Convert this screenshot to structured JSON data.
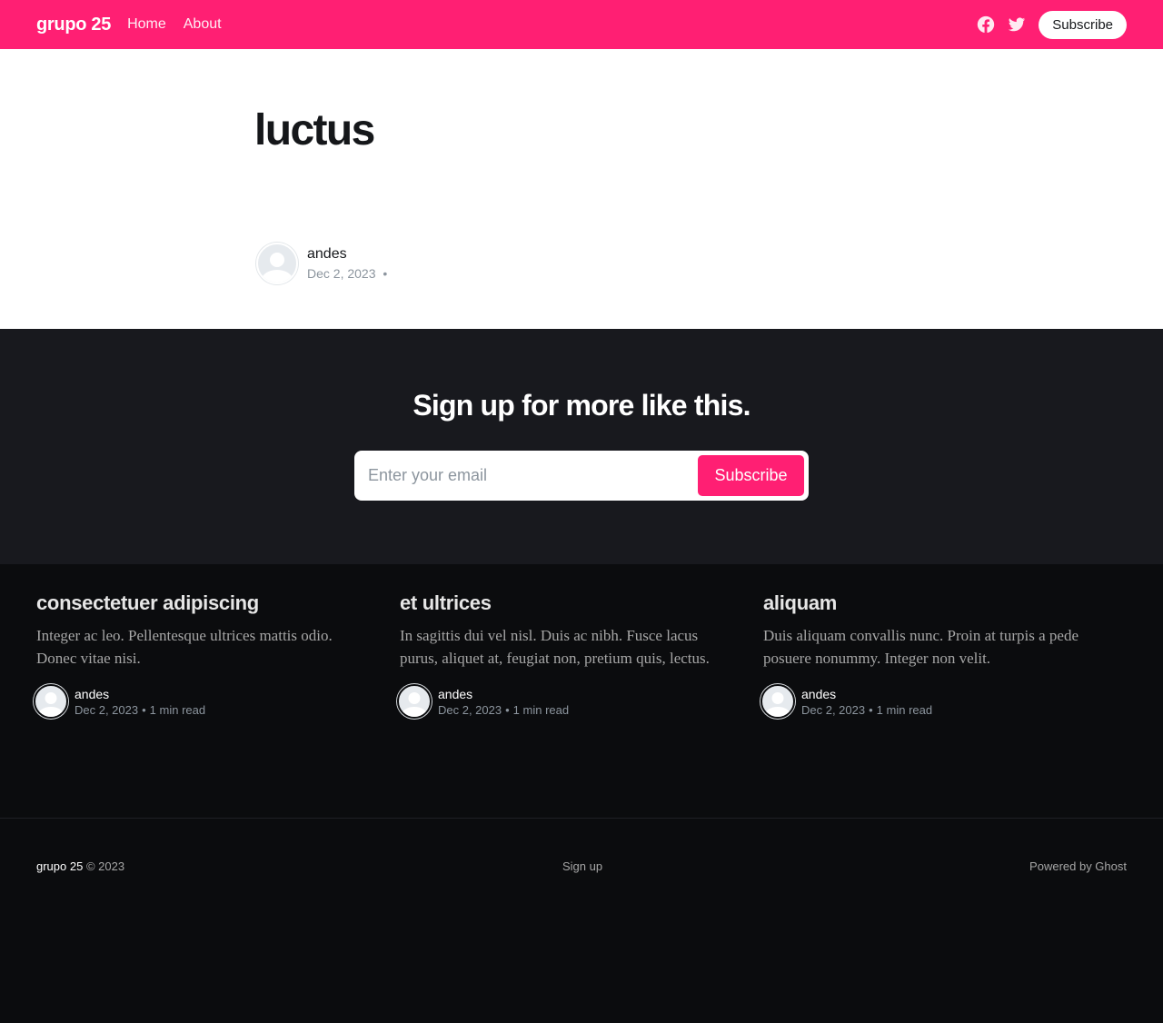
{
  "header": {
    "logo": "grupo 25",
    "nav": [
      {
        "label": "Home"
      },
      {
        "label": "About"
      }
    ],
    "subscribe_label": "Subscribe",
    "social_icons": [
      "facebook-icon",
      "twitter-icon"
    ],
    "accent_color": "#ff1f73"
  },
  "article": {
    "title": "luctus",
    "author": "andes",
    "date": "Dec 2, 2023",
    "separator": "•"
  },
  "signup": {
    "title": "Sign up for more like this.",
    "email_placeholder": "Enter your email",
    "button_label": "Subscribe"
  },
  "related": [
    {
      "title": "consectetuer adipiscing",
      "excerpt": "Integer ac leo. Pellentesque ultrices mattis odio. Donec vitae nisi.",
      "author": "andes",
      "date": "Dec 2, 2023",
      "read_time": "1 min read"
    },
    {
      "title": "et ultrices",
      "excerpt": "In sagittis dui vel nisl. Duis ac nibh. Fusce lacus purus, aliquet at, feugiat non, pretium quis, lectus.",
      "author": "andes",
      "date": "Dec 2, 2023",
      "read_time": "1 min read"
    },
    {
      "title": "aliquam",
      "excerpt": "Duis aliquam convallis nunc. Proin at turpis a pede posuere nonummy. Integer non velit.",
      "author": "andes",
      "date": "Dec 2, 2023",
      "read_time": "1 min read"
    }
  ],
  "footer": {
    "brand": "grupo 25",
    "copyright": "© 2023",
    "signup_link": "Sign up",
    "powered_by": "Powered by Ghost"
  }
}
